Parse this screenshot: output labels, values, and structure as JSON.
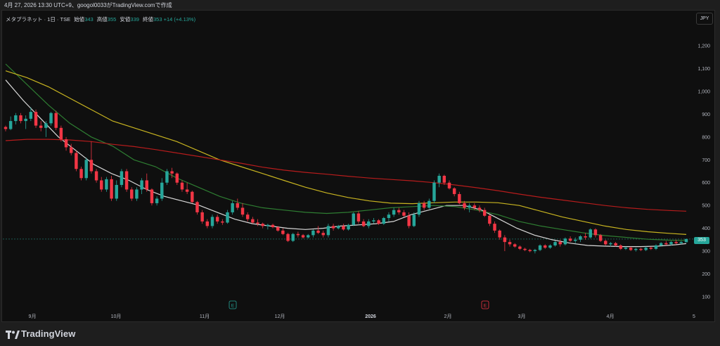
{
  "header": {
    "caption": "4月 27, 2026 13:30 UTC+9、googol0033がTradingView.comで作成"
  },
  "legend": {
    "symbol": "メタプラネット · 1日 · TSE",
    "open_label": "始値",
    "open_value": "343",
    "high_label": "高値",
    "high_value": "355",
    "low_label": "安値",
    "low_value": "339",
    "close_label": "終値",
    "close_value": "353",
    "change": "+14 (+4.13%)"
  },
  "toolbar": {
    "currency": "JPY"
  },
  "price_tag": "353",
  "footer": {
    "brand": "TradingView"
  },
  "colors": {
    "up": "#26a69a",
    "down": "#f23645",
    "ma_fast": "#d9d9d9",
    "ma_mid": "#2e7d32",
    "ma_slow": "#c8b420",
    "ma_long": "#b71c1c",
    "background": "#0f0f0f"
  },
  "chart_data": {
    "type": "candlestick",
    "y_tick_labels": [
      "100",
      "200",
      "300",
      "400",
      "500",
      "600",
      "700",
      "800",
      "900",
      "1,000",
      "1,100",
      "1,200"
    ],
    "x_tick_labels": [
      "9月",
      "10月",
      "11月",
      "12月",
      "2026",
      "2月",
      "3月",
      "4月",
      "5"
    ],
    "ylim": [
      40,
      1270
    ],
    "event_markers": [
      {
        "label": "E",
        "date": "2025-11-13",
        "color": "#26a69a"
      },
      {
        "label": "E",
        "date": "2026-02-13",
        "color": "#f23645"
      }
    ],
    "price_line": 353,
    "candles": [
      [
        844,
        850,
        825,
        835
      ],
      [
        835,
        890,
        830,
        870
      ],
      [
        870,
        905,
        855,
        895
      ],
      [
        895,
        905,
        860,
        870
      ],
      [
        870,
        895,
        835,
        880
      ],
      [
        880,
        930,
        870,
        910
      ],
      [
        910,
        920,
        840,
        850
      ],
      [
        850,
        870,
        825,
        840
      ],
      [
        840,
        870,
        800,
        860
      ],
      [
        860,
        910,
        850,
        905
      ],
      [
        905,
        915,
        830,
        840
      ],
      [
        840,
        850,
        780,
        790
      ],
      [
        790,
        800,
        740,
        755
      ],
      [
        755,
        770,
        720,
        730
      ],
      [
        730,
        740,
        650,
        660
      ],
      [
        660,
        670,
        610,
        620
      ],
      [
        620,
        710,
        610,
        700
      ],
      [
        700,
        780,
        640,
        650
      ],
      [
        650,
        660,
        600,
        610
      ],
      [
        610,
        625,
        560,
        570
      ],
      [
        570,
        625,
        560,
        615
      ],
      [
        615,
        630,
        520,
        530
      ],
      [
        530,
        610,
        520,
        590
      ],
      [
        590,
        660,
        580,
        650
      ],
      [
        650,
        660,
        560,
        570
      ],
      [
        570,
        580,
        520,
        530
      ],
      [
        530,
        580,
        520,
        570
      ],
      [
        570,
        620,
        550,
        610
      ],
      [
        610,
        640,
        560,
        570
      ],
      [
        570,
        575,
        500,
        510
      ],
      [
        510,
        540,
        500,
        530
      ],
      [
        530,
        620,
        520,
        600
      ],
      [
        600,
        660,
        590,
        650
      ],
      [
        650,
        665,
        620,
        640
      ],
      [
        640,
        645,
        590,
        600
      ],
      [
        600,
        610,
        560,
        570
      ],
      [
        570,
        600,
        550,
        560
      ],
      [
        560,
        565,
        510,
        515
      ],
      [
        515,
        520,
        460,
        470
      ],
      [
        470,
        480,
        420,
        430
      ],
      [
        430,
        440,
        400,
        410
      ],
      [
        410,
        460,
        400,
        450
      ],
      [
        450,
        460,
        420,
        430
      ],
      [
        430,
        440,
        415,
        425
      ],
      [
        425,
        480,
        420,
        470
      ],
      [
        470,
        520,
        460,
        510
      ],
      [
        510,
        530,
        480,
        490
      ],
      [
        490,
        510,
        450,
        460
      ],
      [
        460,
        470,
        430,
        440
      ],
      [
        440,
        450,
        420,
        425
      ],
      [
        425,
        440,
        410,
        420
      ],
      [
        420,
        425,
        400,
        410
      ],
      [
        410,
        420,
        395,
        415
      ],
      [
        415,
        420,
        400,
        405
      ],
      [
        405,
        410,
        385,
        390
      ],
      [
        390,
        400,
        370,
        375
      ],
      [
        375,
        380,
        340,
        345
      ],
      [
        345,
        380,
        340,
        375
      ],
      [
        375,
        385,
        360,
        370
      ],
      [
        370,
        375,
        355,
        360
      ],
      [
        360,
        375,
        355,
        370
      ],
      [
        370,
        395,
        360,
        390
      ],
      [
        390,
        410,
        375,
        380
      ],
      [
        380,
        390,
        360,
        370
      ],
      [
        370,
        420,
        360,
        410
      ],
      [
        410,
        420,
        390,
        400
      ],
      [
        400,
        415,
        395,
        410
      ],
      [
        410,
        420,
        390,
        395
      ],
      [
        395,
        420,
        390,
        415
      ],
      [
        415,
        470,
        410,
        465
      ],
      [
        465,
        475,
        420,
        430
      ],
      [
        430,
        440,
        405,
        410
      ],
      [
        410,
        440,
        400,
        430
      ],
      [
        430,
        445,
        420,
        435
      ],
      [
        435,
        440,
        415,
        420
      ],
      [
        420,
        450,
        415,
        445
      ],
      [
        445,
        470,
        430,
        460
      ],
      [
        460,
        490,
        450,
        480
      ],
      [
        480,
        490,
        460,
        470
      ],
      [
        470,
        480,
        450,
        455
      ],
      [
        455,
        470,
        400,
        410
      ],
      [
        410,
        470,
        405,
        460
      ],
      [
        460,
        520,
        450,
        510
      ],
      [
        510,
        520,
        480,
        490
      ],
      [
        490,
        530,
        485,
        520
      ],
      [
        520,
        610,
        510,
        600
      ],
      [
        600,
        640,
        580,
        630
      ],
      [
        630,
        635,
        590,
        600
      ],
      [
        600,
        610,
        570,
        575
      ],
      [
        575,
        580,
        540,
        550
      ],
      [
        550,
        560,
        505,
        510
      ],
      [
        510,
        520,
        480,
        490
      ],
      [
        490,
        510,
        470,
        500
      ],
      [
        500,
        510,
        480,
        490
      ],
      [
        490,
        500,
        470,
        480
      ],
      [
        480,
        490,
        450,
        455
      ],
      [
        455,
        460,
        410,
        420
      ],
      [
        420,
        430,
        380,
        390
      ],
      [
        390,
        395,
        350,
        360
      ],
      [
        360,
        370,
        300,
        340
      ],
      [
        340,
        350,
        320,
        330
      ],
      [
        330,
        335,
        315,
        320
      ],
      [
        320,
        325,
        305,
        310
      ],
      [
        310,
        315,
        300,
        305
      ],
      [
        305,
        310,
        295,
        300
      ],
      [
        300,
        310,
        290,
        305
      ],
      [
        305,
        330,
        300,
        325
      ],
      [
        325,
        330,
        310,
        315
      ],
      [
        315,
        330,
        310,
        325
      ],
      [
        325,
        345,
        320,
        340
      ],
      [
        340,
        350,
        320,
        330
      ],
      [
        330,
        360,
        325,
        355
      ],
      [
        355,
        365,
        340,
        345
      ],
      [
        345,
        360,
        335,
        350
      ],
      [
        350,
        370,
        340,
        365
      ],
      [
        365,
        380,
        350,
        360
      ],
      [
        360,
        400,
        355,
        395
      ],
      [
        395,
        400,
        360,
        370
      ],
      [
        370,
        375,
        340,
        345
      ],
      [
        345,
        350,
        325,
        330
      ],
      [
        330,
        340,
        320,
        335
      ],
      [
        335,
        340,
        320,
        325
      ],
      [
        325,
        330,
        305,
        310
      ],
      [
        310,
        320,
        305,
        315
      ],
      [
        315,
        320,
        300,
        305
      ],
      [
        305,
        315,
        298,
        310
      ],
      [
        310,
        315,
        300,
        305
      ],
      [
        305,
        320,
        300,
        315
      ],
      [
        315,
        320,
        305,
        310
      ],
      [
        310,
        330,
        305,
        325
      ],
      [
        325,
        340,
        320,
        335
      ],
      [
        335,
        345,
        325,
        330
      ],
      [
        330,
        345,
        325,
        340
      ],
      [
        340,
        350,
        330,
        335
      ],
      [
        335,
        345,
        330,
        340
      ],
      [
        339,
        355,
        339,
        353
      ]
    ],
    "moving_averages": [
      {
        "color": "#d9d9d9",
        "points": [
          [
            0,
            1050
          ],
          [
            5,
            960
          ],
          [
            10,
            880
          ],
          [
            15,
            800
          ],
          [
            20,
            740
          ],
          [
            25,
            680
          ],
          [
            30,
            640
          ],
          [
            35,
            610
          ],
          [
            40,
            570
          ],
          [
            45,
            540
          ],
          [
            50,
            520
          ],
          [
            55,
            500
          ],
          [
            60,
            470
          ],
          [
            65,
            440
          ],
          [
            70,
            420
          ],
          [
            75,
            410
          ],
          [
            80,
            400
          ],
          [
            85,
            395
          ],
          [
            90,
            400
          ],
          [
            95,
            410
          ],
          [
            100,
            415
          ],
          [
            105,
            420
          ],
          [
            110,
            430
          ],
          [
            115,
            460
          ],
          [
            120,
            480
          ],
          [
            125,
            500
          ],
          [
            130,
            500
          ],
          [
            135,
            480
          ],
          [
            140,
            440
          ],
          [
            145,
            400
          ],
          [
            150,
            370
          ],
          [
            155,
            350
          ],
          [
            160,
            335
          ],
          [
            165,
            325
          ],
          [
            170,
            322
          ],
          [
            175,
            320
          ],
          [
            180,
            320
          ],
          [
            185,
            322
          ],
          [
            190,
            328
          ],
          [
            193,
            333
          ]
        ]
      },
      {
        "color": "#2e7d32",
        "points": [
          [
            0,
            1120
          ],
          [
            10,
            1030
          ],
          [
            20,
            940
          ],
          [
            30,
            860
          ],
          [
            40,
            800
          ],
          [
            50,
            760
          ],
          [
            60,
            700
          ],
          [
            70,
            670
          ],
          [
            80,
            620
          ],
          [
            90,
            580
          ],
          [
            100,
            540
          ],
          [
            110,
            510
          ],
          [
            120,
            490
          ],
          [
            130,
            480
          ],
          [
            140,
            470
          ],
          [
            150,
            465
          ],
          [
            160,
            470
          ],
          [
            170,
            480
          ],
          [
            180,
            490
          ],
          [
            190,
            495
          ],
          [
            200,
            500
          ],
          [
            210,
            495
          ],
          [
            220,
            480
          ],
          [
            230,
            460
          ],
          [
            240,
            430
          ],
          [
            250,
            410
          ],
          [
            260,
            395
          ],
          [
            270,
            380
          ],
          [
            280,
            368
          ],
          [
            290,
            360
          ],
          [
            300,
            352
          ],
          [
            310,
            348
          ],
          [
            318,
            347
          ]
        ]
      },
      {
        "color": "#c8b420",
        "points": [
          [
            0,
            1090
          ],
          [
            10,
            1060
          ],
          [
            20,
            1020
          ],
          [
            30,
            970
          ],
          [
            40,
            920
          ],
          [
            50,
            870
          ],
          [
            60,
            840
          ],
          [
            70,
            810
          ],
          [
            80,
            780
          ],
          [
            90,
            740
          ],
          [
            100,
            700
          ],
          [
            110,
            670
          ],
          [
            120,
            640
          ],
          [
            130,
            610
          ],
          [
            140,
            580
          ],
          [
            150,
            555
          ],
          [
            160,
            535
          ],
          [
            170,
            520
          ],
          [
            180,
            510
          ],
          [
            190,
            508
          ],
          [
            200,
            512
          ],
          [
            210,
            515
          ],
          [
            220,
            515
          ],
          [
            230,
            512
          ],
          [
            240,
            500
          ],
          [
            250,
            475
          ],
          [
            260,
            450
          ],
          [
            270,
            430
          ],
          [
            280,
            410
          ],
          [
            290,
            395
          ],
          [
            300,
            385
          ],
          [
            310,
            378
          ],
          [
            318,
            373
          ]
        ]
      },
      {
        "color": "#b71c1c",
        "points": [
          [
            0,
            784
          ],
          [
            10,
            790
          ],
          [
            20,
            790
          ],
          [
            30,
            787
          ],
          [
            40,
            780
          ],
          [
            50,
            768
          ],
          [
            60,
            758
          ],
          [
            70,
            745
          ],
          [
            80,
            730
          ],
          [
            90,
            715
          ],
          [
            100,
            700
          ],
          [
            110,
            685
          ],
          [
            120,
            668
          ],
          [
            130,
            655
          ],
          [
            140,
            645
          ],
          [
            150,
            637
          ],
          [
            160,
            628
          ],
          [
            170,
            620
          ],
          [
            180,
            614
          ],
          [
            190,
            608
          ],
          [
            200,
            600
          ],
          [
            210,
            590
          ],
          [
            220,
            578
          ],
          [
            230,
            565
          ],
          [
            240,
            550
          ],
          [
            250,
            536
          ],
          [
            260,
            524
          ],
          [
            270,
            512
          ],
          [
            280,
            500
          ],
          [
            290,
            490
          ],
          [
            300,
            483
          ],
          [
            310,
            478
          ],
          [
            318,
            475
          ]
        ]
      }
    ]
  }
}
